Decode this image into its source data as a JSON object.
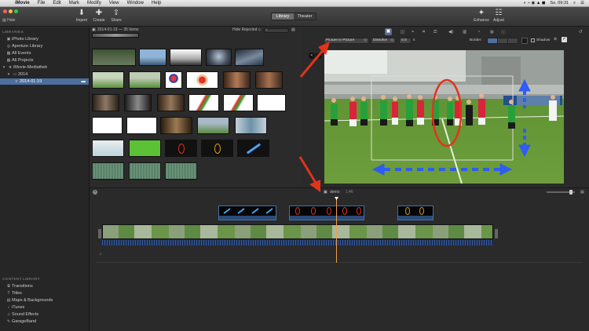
{
  "menubar": {
    "apple": "",
    "items": [
      "iMovie",
      "File",
      "Edit",
      "Mark",
      "Modify",
      "View",
      "Window",
      "Help"
    ],
    "clock": "So. 09:31"
  },
  "toolbar": {
    "hide_label": "Hide",
    "import_label": "Import",
    "create_label": "Create",
    "share_label": "Share",
    "library_tab": "Library",
    "theater_tab": "Theater",
    "enhance_label": "Enhance",
    "adjust_label": "Adjust"
  },
  "sidebar": {
    "libraries_header": "LIBRARIES",
    "items": [
      {
        "label": "iPhoto Library",
        "icon": "photo-icon"
      },
      {
        "label": "Aperture Library",
        "icon": "aperture-icon"
      },
      {
        "label": "All Events",
        "icon": "film-icon"
      },
      {
        "label": "All Projects",
        "icon": "film-icon"
      },
      {
        "label": "iMovie-Mediathek",
        "icon": "disclosure-icon"
      },
      {
        "label": "2014",
        "icon": "folder-icon"
      },
      {
        "label": "2014-01-19",
        "icon": "star-icon"
      }
    ],
    "content_library_header": "CONTENT LIBRARY",
    "content_items": [
      {
        "label": "Transitions",
        "icon": "transitions-icon"
      },
      {
        "label": "Titles",
        "icon": "titles-icon"
      },
      {
        "label": "Maps & Backgrounds",
        "icon": "map-icon"
      },
      {
        "label": "iTunes",
        "icon": "music-icon"
      },
      {
        "label": "Sound Effects",
        "icon": "sound-icon"
      },
      {
        "label": "GarageBand",
        "icon": "guitar-icon"
      }
    ]
  },
  "browser": {
    "event_title": "2014-01-19 — 35 Items",
    "hide_rejected": "Hide Rejected",
    "search_placeholder": ""
  },
  "viewer": {
    "overlay_mode": "Picture in Picture",
    "transition": "Dissolve",
    "duration": "0,0",
    "border_label": "Border:",
    "shadow_label": "Shadow"
  },
  "timeline": {
    "project_name": "demo",
    "project_duration": "1:46"
  },
  "colors": {
    "accent": "#4d6f9e",
    "arrow_red": "#e2331b",
    "arrow_blue": "#2f5cf2",
    "pip_green": "#5bc236"
  }
}
